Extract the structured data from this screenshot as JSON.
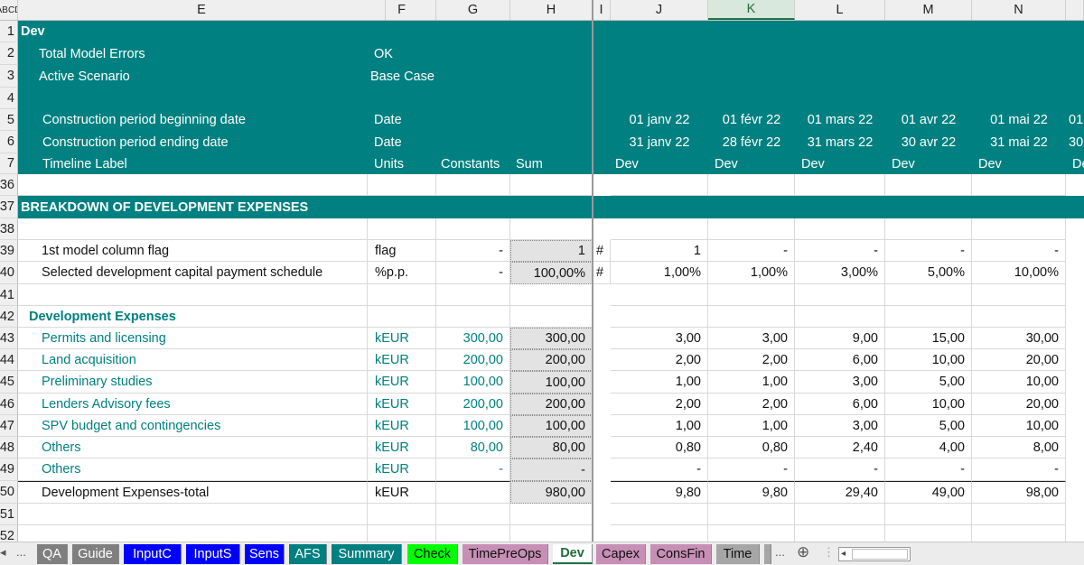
{
  "col_headers": {
    "a": "A",
    "b": "B",
    "c": "C",
    "d": "D",
    "e": "E",
    "f": "F",
    "g": "G",
    "h": "H",
    "i": "I",
    "j": "J",
    "k": "K",
    "l": "L",
    "m": "M",
    "n": "N"
  },
  "row_numbers": [
    "1",
    "2",
    "3",
    "4",
    "5",
    "6",
    "7",
    "36",
    "37",
    "38",
    "39",
    "40",
    "41",
    "42",
    "43",
    "44",
    "45",
    "46",
    "47",
    "48",
    "49",
    "50",
    "51",
    "52"
  ],
  "header": {
    "title": "Dev",
    "total_errors_label": "Total Model Errors",
    "total_errors_value": "OK",
    "scenario_label": "Active Scenario",
    "scenario_value": "Base Case",
    "begin_label": "Construction period beginning date",
    "begin_unit": "Date",
    "end_label": "Construction period ending date",
    "end_unit": "Date",
    "timeline_label": "Timeline Label",
    "units_label": "Units",
    "constants_label": "Constants",
    "sum_label": "Sum",
    "begin_dates": [
      "01 janv 22",
      "01 févr 22",
      "01 mars 22",
      "01 avr 22",
      "01 mai 22",
      "01"
    ],
    "end_dates": [
      "31 janv 22",
      "28 févr 22",
      "31 mars 22",
      "30 avr 22",
      "31 mai 22",
      "30"
    ],
    "timeline": [
      "Dev",
      "Dev",
      "Dev",
      "Dev",
      "Dev",
      "De"
    ]
  },
  "section_title": "BREAKDOWN OF DEVELOPMENT EXPENSES",
  "flag_row": {
    "label": "1st model column flag",
    "unit": "flag",
    "constant": "-",
    "sum": "1",
    "marker": "#",
    "values": [
      "1",
      "-",
      "-",
      "-",
      "-"
    ]
  },
  "schedule_row": {
    "label": "Selected development capital payment schedule",
    "unit": "%p.p.",
    "constant": "-",
    "sum": "100,00%",
    "marker": "#",
    "values": [
      "1,00%",
      "1,00%",
      "3,00%",
      "5,00%",
      "10,00%"
    ]
  },
  "dev_title": "Development Expenses",
  "items": [
    {
      "label": "Permits and licensing",
      "unit": "kEUR",
      "constant": "300,00",
      "sum": "300,00",
      "values": [
        "3,00",
        "3,00",
        "9,00",
        "15,00",
        "30,00"
      ]
    },
    {
      "label": "Land acquisition",
      "unit": "kEUR",
      "constant": "200,00",
      "sum": "200,00",
      "values": [
        "2,00",
        "2,00",
        "6,00",
        "10,00",
        "20,00"
      ]
    },
    {
      "label": "Preliminary studies",
      "unit": "kEUR",
      "constant": "100,00",
      "sum": "100,00",
      "values": [
        "1,00",
        "1,00",
        "3,00",
        "5,00",
        "10,00"
      ]
    },
    {
      "label": "Lenders Advisory fees",
      "unit": "kEUR",
      "constant": "200,00",
      "sum": "200,00",
      "values": [
        "2,00",
        "2,00",
        "6,00",
        "10,00",
        "20,00"
      ]
    },
    {
      "label": "SPV budget and contingencies",
      "unit": "kEUR",
      "constant": "100,00",
      "sum": "100,00",
      "values": [
        "1,00",
        "1,00",
        "3,00",
        "5,00",
        "10,00"
      ]
    },
    {
      "label": "Others",
      "unit": "kEUR",
      "constant": "80,00",
      "sum": "80,00",
      "values": [
        "0,80",
        "0,80",
        "2,40",
        "4,00",
        "8,00"
      ]
    },
    {
      "label": "Others",
      "unit": "kEUR",
      "constant": "-",
      "sum": "-",
      "values": [
        "-",
        "-",
        "-",
        "-",
        "-"
      ]
    }
  ],
  "total_row": {
    "label": "Development Expenses-total",
    "unit": "kEUR",
    "sum": "980,00",
    "values": [
      "9,80",
      "9,80",
      "29,40",
      "49,00",
      "98,00"
    ]
  },
  "tabs": [
    {
      "label": "QA",
      "bg": "#7f7f7f",
      "fg": "#ffffff"
    },
    {
      "label": "Guide",
      "bg": "#7f7f7f",
      "fg": "#ffffff"
    },
    {
      "label": "InputC",
      "bg": "#0000ff",
      "fg": "#ffffff"
    },
    {
      "label": "InputS",
      "bg": "#0000ff",
      "fg": "#ffffff"
    },
    {
      "label": "Sens",
      "bg": "#0000ff",
      "fg": "#ffffff"
    },
    {
      "label": "AFS",
      "bg": "#008080",
      "fg": "#ffffff"
    },
    {
      "label": "Summary",
      "bg": "#008080",
      "fg": "#ffffff"
    },
    {
      "label": "Check",
      "bg": "#00ff00",
      "fg": "#111111"
    },
    {
      "label": "TimePreOps",
      "bg": "#c78fb5",
      "fg": "#111111"
    },
    {
      "label": "Dev",
      "bg": "#ffffff",
      "fg": "#1f6e3a"
    },
    {
      "label": "Capex",
      "bg": "#c78fb5",
      "fg": "#111111"
    },
    {
      "label": "ConsFin",
      "bg": "#c78fb5",
      "fg": "#111111"
    },
    {
      "label": "Time",
      "bg": "#a6a6a6",
      "fg": "#111111"
    }
  ],
  "tab_nav": {
    "prev": "◂",
    "ellipsis": "...",
    "more": "...",
    "add": "⊕",
    "scroll_left": "◂"
  }
}
